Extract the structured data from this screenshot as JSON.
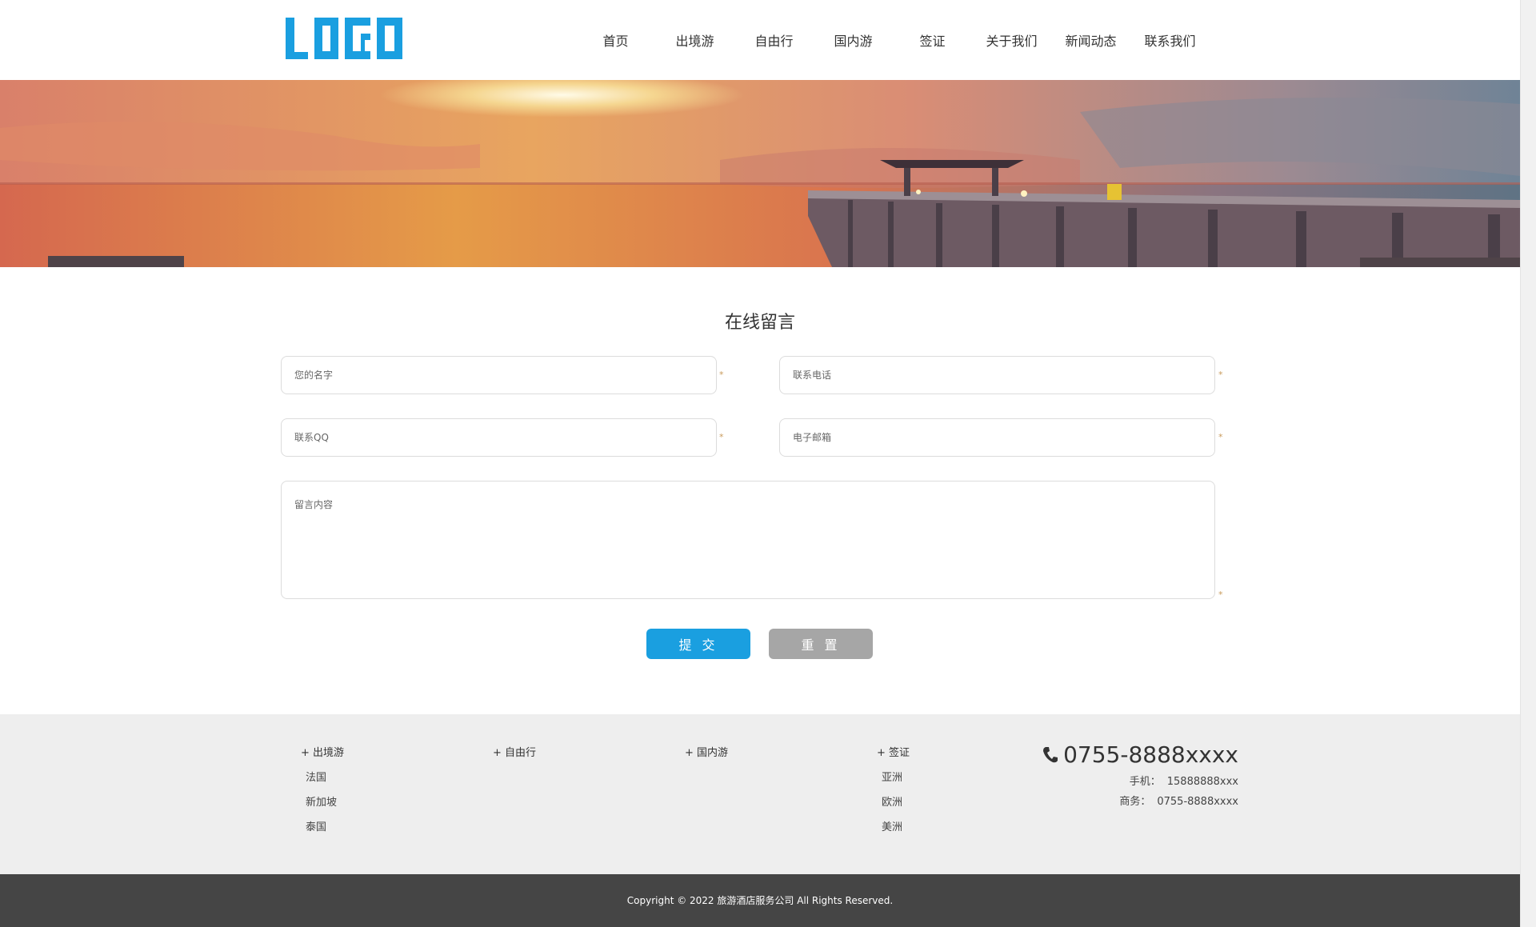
{
  "header": {
    "logo_text": "LOGO",
    "nav": [
      "首页",
      "出境游",
      "自由行",
      "国内游",
      "签证",
      "关于我们",
      "新闻动态",
      "联系我们"
    ]
  },
  "form": {
    "title": "在线留言",
    "name_placeholder": "您的名字",
    "phone_placeholder": "联系电话",
    "qq_placeholder": "联系QQ",
    "email_placeholder": "电子邮箱",
    "message_placeholder": "留言内容",
    "required_mark": "*",
    "submit_label": "提 交",
    "reset_label": "重 置"
  },
  "footer": {
    "columns": [
      {
        "head": "+ 出境游",
        "items": [
          "法国",
          "新加坡",
          "泰国"
        ]
      },
      {
        "head": "+ 自由行",
        "items": []
      },
      {
        "head": "+ 国内游",
        "items": []
      },
      {
        "head": "+ 签证",
        "items": [
          "亚洲",
          "欧洲",
          "美洲"
        ]
      }
    ],
    "hotline": "0755-8888xxxx",
    "mobile_label": "手机：",
    "mobile_value": "15888888xxx",
    "business_label": "商务：",
    "business_value": "0755-8888xxxx",
    "copyright": "Copyright © 2022 旅游酒店服务公司 All Rights Reserved."
  },
  "colors": {
    "brand_blue": "#1a9fe0",
    "reset_gray": "#a6a6a6",
    "footer_bg": "#eeeeee",
    "copyright_bg": "#454545"
  },
  "icons": {
    "phone": "phone-icon"
  }
}
